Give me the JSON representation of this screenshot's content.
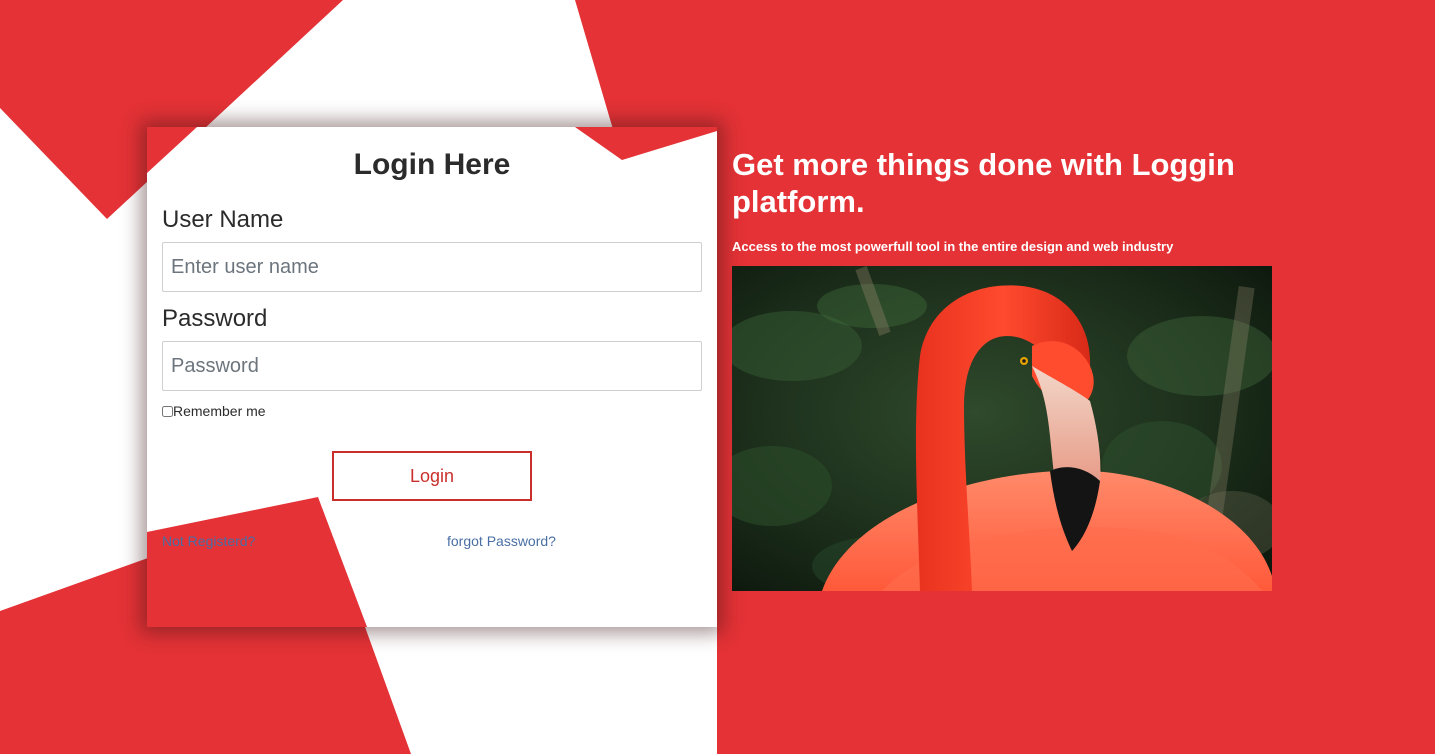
{
  "colors": {
    "accent_red": "#e43236",
    "button_red": "#c9302c",
    "link_blue": "#4a6fa5"
  },
  "login": {
    "title": "Login Here",
    "username_label": "User Name",
    "username_placeholder": "Enter user name",
    "password_label": "Password",
    "password_placeholder": "Password",
    "remember_label": "Remember me",
    "login_button": "Login",
    "not_registered_link": "Not Registerd?",
    "forgot_password_link": "forgot Password?"
  },
  "promo": {
    "heading": "Get more things done with Loggin platform.",
    "subtext": "Access to the most powerfull tool in the entire design and web industry",
    "image_subject": "flamingo-photo"
  }
}
